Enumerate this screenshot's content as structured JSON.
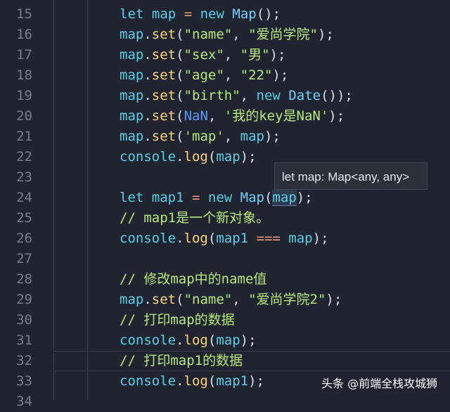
{
  "editor": {
    "lines": [
      {
        "n": "15",
        "tokens": [
          {
            "t": "    ",
            "c": "punc"
          },
          {
            "t": "let",
            "c": "kw"
          },
          {
            "t": " map ",
            "c": "ident"
          },
          {
            "t": "=",
            "c": "op"
          },
          {
            "t": " ",
            "c": "punc"
          },
          {
            "t": "new",
            "c": "kw"
          },
          {
            "t": " ",
            "c": "punc"
          },
          {
            "t": "Map",
            "c": "class"
          },
          {
            "t": "();",
            "c": "punc"
          }
        ]
      },
      {
        "n": "16",
        "tokens": [
          {
            "t": "map",
            "c": "ident"
          },
          {
            "t": ".",
            "c": "punc"
          },
          {
            "t": "set",
            "c": "fn"
          },
          {
            "t": "(",
            "c": "punc"
          },
          {
            "t": "\"name\"",
            "c": "str"
          },
          {
            "t": ", ",
            "c": "punc"
          },
          {
            "t": "\"爱尚学院\"",
            "c": "str"
          },
          {
            "t": ");",
            "c": "punc"
          }
        ]
      },
      {
        "n": "17",
        "tokens": [
          {
            "t": "map",
            "c": "ident"
          },
          {
            "t": ".",
            "c": "punc"
          },
          {
            "t": "set",
            "c": "fn"
          },
          {
            "t": "(",
            "c": "punc"
          },
          {
            "t": "\"sex\"",
            "c": "str"
          },
          {
            "t": ", ",
            "c": "punc"
          },
          {
            "t": "\"男\"",
            "c": "str"
          },
          {
            "t": ");",
            "c": "punc"
          }
        ]
      },
      {
        "n": "18",
        "tokens": [
          {
            "t": "map",
            "c": "ident"
          },
          {
            "t": ".",
            "c": "punc"
          },
          {
            "t": "set",
            "c": "fn"
          },
          {
            "t": "(",
            "c": "punc"
          },
          {
            "t": "\"age\"",
            "c": "str"
          },
          {
            "t": ", ",
            "c": "punc"
          },
          {
            "t": "\"22\"",
            "c": "str"
          },
          {
            "t": ");",
            "c": "punc"
          }
        ]
      },
      {
        "n": "19",
        "tokens": [
          {
            "t": "map",
            "c": "ident"
          },
          {
            "t": ".",
            "c": "punc"
          },
          {
            "t": "set",
            "c": "fn"
          },
          {
            "t": "(",
            "c": "punc"
          },
          {
            "t": "\"birth\"",
            "c": "str"
          },
          {
            "t": ", ",
            "c": "punc"
          },
          {
            "t": "new",
            "c": "kw"
          },
          {
            "t": " ",
            "c": "punc"
          },
          {
            "t": "Date",
            "c": "class"
          },
          {
            "t": "());",
            "c": "punc"
          }
        ]
      },
      {
        "n": "20",
        "tokens": [
          {
            "t": "map",
            "c": "ident"
          },
          {
            "t": ".",
            "c": "punc"
          },
          {
            "t": "set",
            "c": "fn"
          },
          {
            "t": "(",
            "c": "punc"
          },
          {
            "t": "NaN",
            "c": "nan"
          },
          {
            "t": ", ",
            "c": "punc"
          },
          {
            "t": "'我的key是NaN'",
            "c": "str"
          },
          {
            "t": ");",
            "c": "punc"
          }
        ]
      },
      {
        "n": "21",
        "tokens": [
          {
            "t": "map",
            "c": "ident"
          },
          {
            "t": ".",
            "c": "punc"
          },
          {
            "t": "set",
            "c": "fn"
          },
          {
            "t": "(",
            "c": "punc"
          },
          {
            "t": "'map'",
            "c": "str"
          },
          {
            "t": ", ",
            "c": "punc"
          },
          {
            "t": "map",
            "c": "ident"
          },
          {
            "t": ");",
            "c": "punc"
          }
        ]
      },
      {
        "n": "22",
        "tokens": [
          {
            "t": "console",
            "c": "ident"
          },
          {
            "t": ".",
            "c": "punc"
          },
          {
            "t": "log",
            "c": "fn"
          },
          {
            "t": "(",
            "c": "punc"
          },
          {
            "t": "map",
            "c": "ident"
          },
          {
            "t": ");",
            "c": "punc"
          }
        ]
      },
      {
        "n": "23",
        "tokens": []
      },
      {
        "n": "24",
        "tokens": [
          {
            "t": "let",
            "c": "kw"
          },
          {
            "t": " map1 ",
            "c": "ident"
          },
          {
            "t": "=",
            "c": "op"
          },
          {
            "t": " ",
            "c": "punc"
          },
          {
            "t": "new",
            "c": "kw"
          },
          {
            "t": " ",
            "c": "punc"
          },
          {
            "t": "Map",
            "c": "class"
          },
          {
            "t": "(",
            "c": "punc"
          },
          {
            "t": "map",
            "c": "ident",
            "hl": true
          },
          {
            "t": ");",
            "c": "punc"
          }
        ]
      },
      {
        "n": "25",
        "tokens": [
          {
            "t": "// map1是一个新对象。",
            "c": "comment"
          }
        ]
      },
      {
        "n": "26",
        "tokens": [
          {
            "t": "console",
            "c": "ident"
          },
          {
            "t": ".",
            "c": "punc"
          },
          {
            "t": "log",
            "c": "fn"
          },
          {
            "t": "(",
            "c": "punc"
          },
          {
            "t": "map1 ",
            "c": "ident"
          },
          {
            "t": "===",
            "c": "op"
          },
          {
            "t": " ",
            "c": "punc"
          },
          {
            "t": "map",
            "c": "ident"
          },
          {
            "t": ");",
            "c": "punc"
          }
        ]
      },
      {
        "n": "27",
        "tokens": []
      },
      {
        "n": "28",
        "tokens": [
          {
            "t": "// 修改map中的name值",
            "c": "comment"
          }
        ]
      },
      {
        "n": "29",
        "tokens": [
          {
            "t": "map",
            "c": "ident"
          },
          {
            "t": ".",
            "c": "punc"
          },
          {
            "t": "set",
            "c": "fn"
          },
          {
            "t": "(",
            "c": "punc"
          },
          {
            "t": "\"name\"",
            "c": "str"
          },
          {
            "t": ", ",
            "c": "punc"
          },
          {
            "t": "\"爱尚学院2\"",
            "c": "str"
          },
          {
            "t": ");",
            "c": "punc"
          }
        ]
      },
      {
        "n": "30",
        "tokens": [
          {
            "t": "// 打印map的数据",
            "c": "comment"
          }
        ]
      },
      {
        "n": "31",
        "tokens": [
          {
            "t": "console",
            "c": "ident"
          },
          {
            "t": ".",
            "c": "punc"
          },
          {
            "t": "log",
            "c": "fn"
          },
          {
            "t": "(",
            "c": "punc"
          },
          {
            "t": "map",
            "c": "ident"
          },
          {
            "t": ");",
            "c": "punc"
          }
        ]
      },
      {
        "n": "32",
        "tokens": [
          {
            "t": "// 打印map1的数据",
            "c": "comment"
          }
        ]
      },
      {
        "n": "33",
        "tokens": [
          {
            "t": "console",
            "c": "ident"
          },
          {
            "t": ".",
            "c": "punc"
          },
          {
            "t": "log",
            "c": "fn"
          },
          {
            "t": "(",
            "c": "punc"
          },
          {
            "t": "map1",
            "c": "ident"
          },
          {
            "t": ");",
            "c": "punc"
          }
        ]
      },
      {
        "n": "34",
        "tokens": []
      }
    ]
  },
  "tooltip": {
    "text": "let map: Map<any, any>"
  },
  "watermark": {
    "text": "头条 @前端全栈攻城狮"
  },
  "colors": {
    "background": "#1f2430",
    "keyword": "#5ccfe6",
    "string": "#bae67e",
    "function": "#ffd580",
    "class": "#73d0ff",
    "operator": "#f29e74",
    "line_number": "#777f8c"
  }
}
